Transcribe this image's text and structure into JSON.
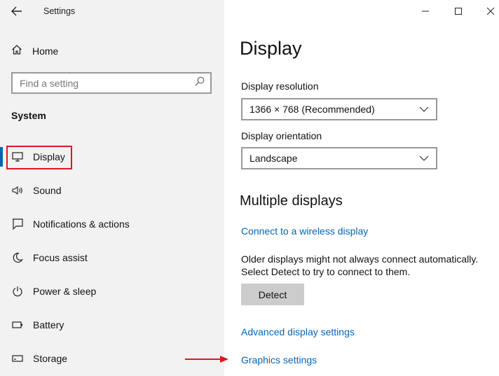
{
  "window": {
    "title": "Settings",
    "controls": {
      "minimize": "minimize-icon",
      "maximize": "maximize-icon",
      "close": "close-icon"
    }
  },
  "sidebar": {
    "home_label": "Home",
    "search_placeholder": "Find a setting",
    "section_title": "System",
    "items": [
      {
        "label": "Display",
        "icon": "monitor-icon",
        "active": true
      },
      {
        "label": "Sound",
        "icon": "speaker-icon"
      },
      {
        "label": "Notifications & actions",
        "icon": "notification-icon"
      },
      {
        "label": "Focus assist",
        "icon": "moon-icon"
      },
      {
        "label": "Power & sleep",
        "icon": "power-icon"
      },
      {
        "label": "Battery",
        "icon": "battery-icon"
      },
      {
        "label": "Storage",
        "icon": "storage-icon"
      }
    ]
  },
  "main": {
    "title": "Display",
    "resolution": {
      "label": "Display resolution",
      "value": "1366 × 768 (Recommended)"
    },
    "orientation": {
      "label": "Display orientation",
      "value": "Landscape"
    },
    "multiple_displays": {
      "heading": "Multiple displays",
      "connect_link": "Connect to a wireless display",
      "note_line1": "Older displays might not always connect automatically.",
      "note_line2": "Select Detect to try to connect to them.",
      "detect_button": "Detect"
    },
    "advanced_link": "Advanced display settings",
    "graphics_link": "Graphics settings"
  },
  "colors": {
    "accent": "#0063b1",
    "link": "#0067b8",
    "highlight": "#e2141f"
  }
}
